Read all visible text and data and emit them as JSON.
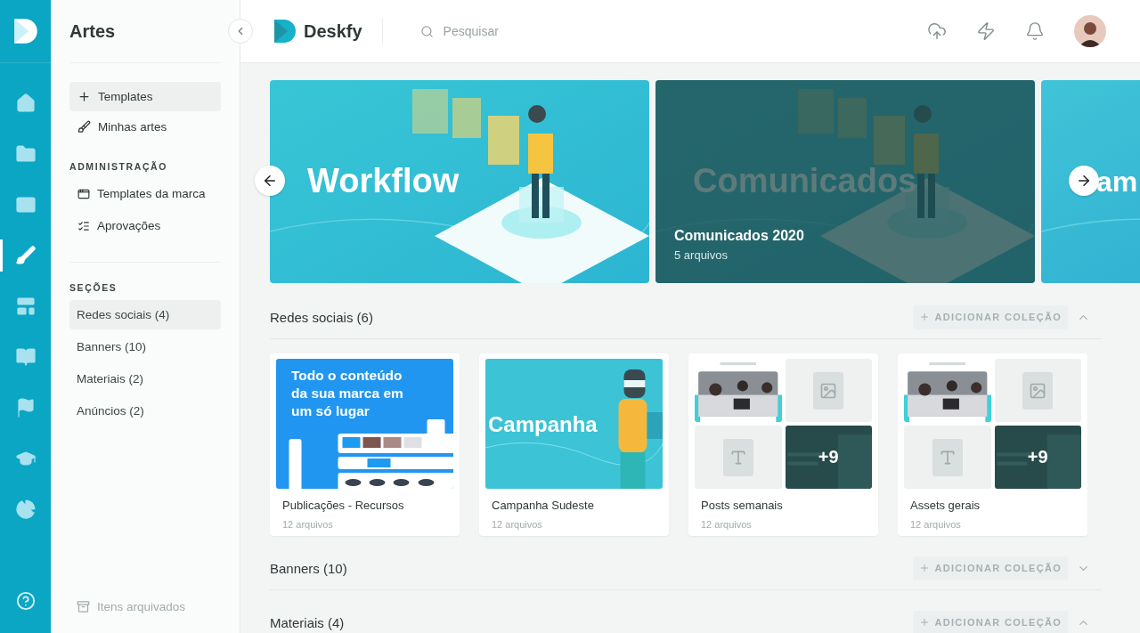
{
  "rail": {
    "items": [
      {
        "selected": false
      },
      {
        "selected": false
      },
      {
        "selected": false
      },
      {
        "selected": true
      },
      {
        "selected": false
      },
      {
        "selected": false
      },
      {
        "selected": false
      },
      {
        "selected": false
      },
      {
        "selected": false
      }
    ]
  },
  "sidebar": {
    "title": "Artes",
    "nav": [
      {
        "label": "Templates",
        "selected": true
      },
      {
        "label": "Minhas artes",
        "selected": false
      }
    ],
    "groups": [
      {
        "heading": "ADMINISTRAÇÃO",
        "items": [
          {
            "label": "Templates da marca",
            "selected": false
          },
          {
            "label": "Aprovações",
            "selected": false
          }
        ]
      }
    ],
    "sections_heading": "SEÇÕES",
    "sections": [
      {
        "label": "Redes sociais (4)",
        "selected": true
      },
      {
        "label": "Banners (10)",
        "selected": false
      },
      {
        "label": "Materiais (2)",
        "selected": false
      },
      {
        "label": "Anúncios (2)",
        "selected": false
      }
    ],
    "archived": "Itens arquivados"
  },
  "topbar": {
    "brand": "Deskfy",
    "search": {
      "placeholder": "Pesquisar"
    }
  },
  "hero": {
    "cards": [
      {
        "kind": "banner",
        "headline": "Workflow",
        "dimmed": false
      },
      {
        "kind": "banner",
        "headline": "Comunicados",
        "dimmed": true,
        "caption": "Comunicados 2020",
        "count": "5 arquivos"
      },
      {
        "kind": "banner",
        "headline": "am",
        "dimmed": false
      }
    ]
  },
  "sections": [
    {
      "title": "Redes sociais (6)",
      "action": "ADICIONAR COLEÇÃO",
      "expanded": true,
      "collections": [
        {
          "name": "Publicações - Recursos",
          "count": "12 arquivos",
          "thumb": {
            "kind": "mockup",
            "headline": "Todo o conteúdo da sua marca em um só lugar"
          }
        },
        {
          "name": "Campanha Sudeste",
          "count": "12 arquivos",
          "thumb": {
            "kind": "campaign",
            "headline": "Campanha"
          }
        },
        {
          "name": "Posts semanais",
          "count": "12 arquivos",
          "thumb": {
            "kind": "grid",
            "more": "+9"
          }
        },
        {
          "name": "Assets gerais",
          "count": "12 arquivos",
          "thumb": {
            "kind": "grid",
            "more": "+9"
          }
        }
      ]
    },
    {
      "title": "Banners (10)",
      "action": "ADICIONAR COLEÇÃO",
      "expanded": false
    },
    {
      "title": "Materiais (4)",
      "action": "ADICIONAR COLEÇÃO",
      "expanded": true
    }
  ]
}
